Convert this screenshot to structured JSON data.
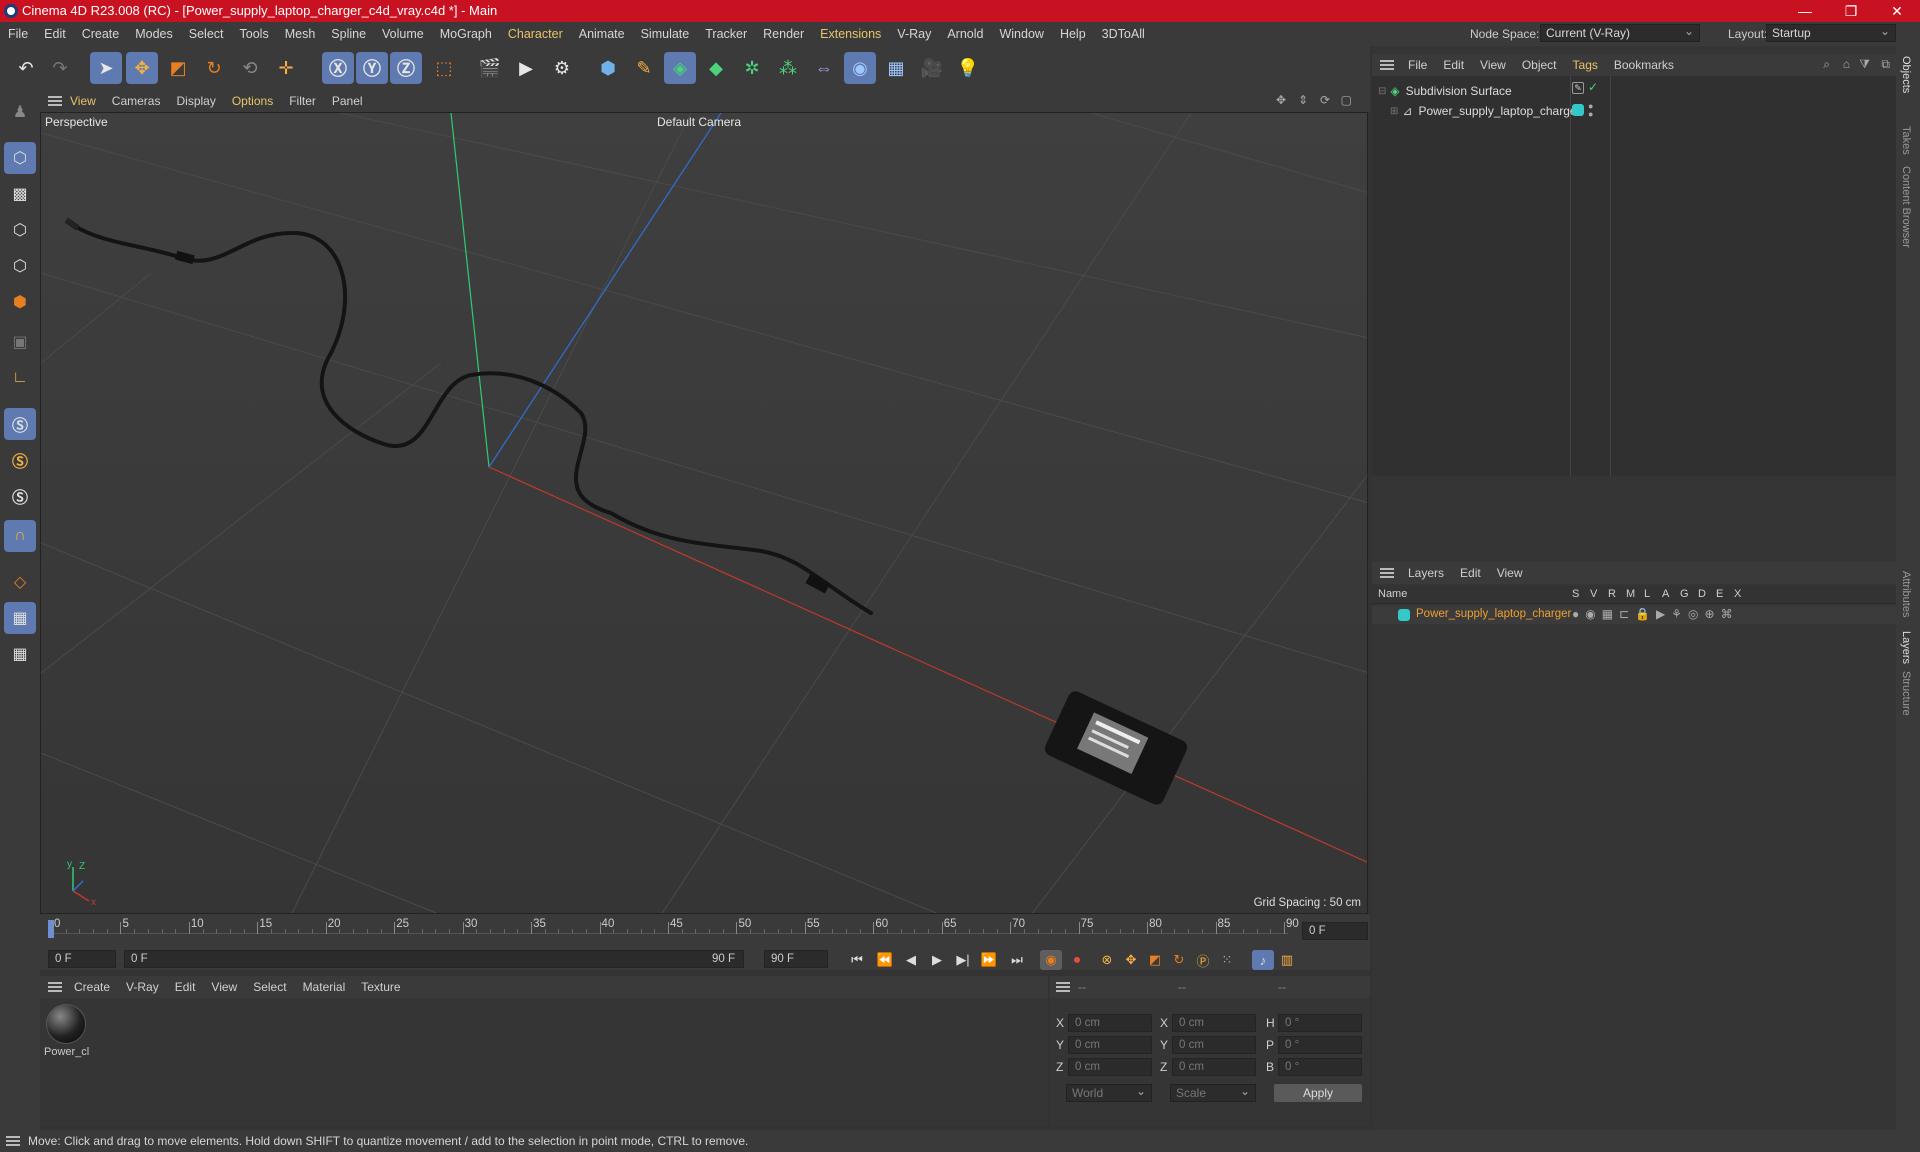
{
  "title": "Cinema 4D R23.008 (RC) - [Power_supply_laptop_charger_c4d_vray.c4d *] - Main",
  "menu": [
    "File",
    "Edit",
    "Create",
    "Modes",
    "Select",
    "Tools",
    "Mesh",
    "Spline",
    "Volume",
    "MoGraph",
    "Character",
    "Animate",
    "Simulate",
    "Tracker",
    "Render",
    "Extensions",
    "V-Ray",
    "Arnold",
    "Window",
    "Help",
    "3DToAll"
  ],
  "node_space": {
    "label": "Node Space:",
    "value": "Current (V-Ray)"
  },
  "layout": {
    "label": "Layout:",
    "value": "Startup"
  },
  "viewport_menu": [
    "View",
    "Cameras",
    "Display",
    "Options",
    "Filter",
    "Panel"
  ],
  "viewport": {
    "name": "Perspective",
    "camera": "Default Camera",
    "grid_spacing": "Grid Spacing : 50 cm"
  },
  "timeline": {
    "ticks": [
      "0",
      "5",
      "10",
      "15",
      "20",
      "25",
      "30",
      "35",
      "40",
      "45",
      "50",
      "55",
      "60",
      "65",
      "70",
      "75",
      "80",
      "85",
      "90"
    ],
    "current_frame": "0 F"
  },
  "transport": {
    "start": "0 F",
    "range_start": "0 F",
    "range_end": "90 F",
    "end": "90 F"
  },
  "material_menu": [
    "Create",
    "V-Ray",
    "Edit",
    "View",
    "Select",
    "Material",
    "Texture"
  ],
  "material": {
    "name": "Power_cl"
  },
  "coords": {
    "headers": [
      "--",
      "--",
      "--"
    ],
    "rows": [
      {
        "a": "X",
        "av": "0 cm",
        "b": "X",
        "bv": "0 cm",
        "c": "H",
        "cv": "0 °"
      },
      {
        "a": "Y",
        "av": "0 cm",
        "b": "Y",
        "bv": "0 cm",
        "c": "P",
        "cv": "0 °"
      },
      {
        "a": "Z",
        "av": "0 cm",
        "b": "Z",
        "bv": "0 cm",
        "c": "B",
        "cv": "0 °"
      }
    ],
    "space": "World",
    "mode": "Scale",
    "apply": "Apply"
  },
  "object_menu": [
    "File",
    "Edit",
    "View",
    "Object",
    "Tags",
    "Bookmarks"
  ],
  "objects": [
    {
      "name": "Subdivision Surface"
    },
    {
      "name": "Power_supply_laptop_charger"
    }
  ],
  "layers_menu": [
    "Layers",
    "Edit",
    "View"
  ],
  "layers_header": {
    "name": "Name",
    "cols": [
      "S",
      "V",
      "R",
      "M",
      "L",
      "A",
      "G",
      "D",
      "E",
      "X"
    ]
  },
  "layers": [
    {
      "name": "Power_supply_laptop_charger",
      "color": "#35c8c8"
    }
  ],
  "side_tabs": [
    "Objects",
    "Takes",
    "Content Browser",
    "Attributes",
    "Layers",
    "Structure"
  ],
  "status": "Move: Click and drag to move elements. Hold down SHIFT to quantize movement / add to the selection in point mode, CTRL to remove.",
  "colors": {
    "accent": "#5e7ab0",
    "highlight": "#e9c46a",
    "titlebar": "#c81221",
    "layer": "#35c8c8"
  }
}
